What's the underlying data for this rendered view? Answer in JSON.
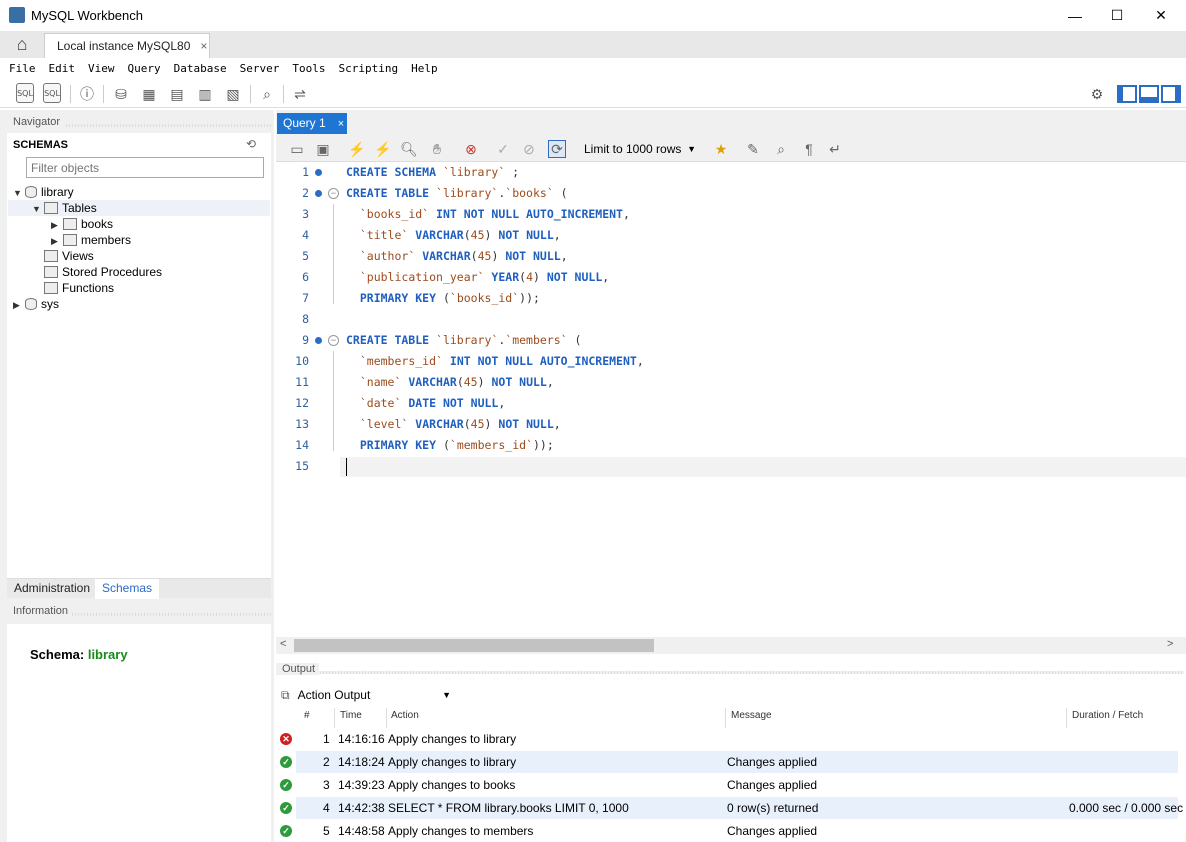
{
  "window": {
    "title": "MySQL Workbench",
    "minimize": "—",
    "maximize": "☐",
    "close": "✕"
  },
  "tabs": {
    "connection": "Local instance MySQL80",
    "close": "×"
  },
  "menu": [
    "File",
    "Edit",
    "View",
    "Query",
    "Database",
    "Server",
    "Tools",
    "Scripting",
    "Help"
  ],
  "navigator": {
    "header": "Navigator",
    "schemas_title": "SCHEMAS",
    "filter_placeholder": "Filter objects",
    "tree": {
      "library": "library",
      "tables": "Tables",
      "books": "books",
      "members": "members",
      "views": "Views",
      "stored_procedures": "Stored Procedures",
      "functions": "Functions",
      "sys": "sys"
    },
    "tabs": {
      "administration": "Administration",
      "schemas": "Schemas"
    },
    "info_header": "Information",
    "schema_label": "Schema:",
    "schema_value": "library"
  },
  "query": {
    "tab_label": "Query 1",
    "tab_close": "×",
    "limit_label": "Limit to 1000 rows",
    "line_numbers": [
      "1",
      "2",
      "3",
      "4",
      "5",
      "6",
      "7",
      "8",
      "9",
      "10",
      "11",
      "12",
      "13",
      "14",
      "15"
    ]
  },
  "output": {
    "header": "Output",
    "combo_label": "Action Output",
    "columns": {
      "num": "#",
      "time": "Time",
      "action": "Action",
      "message": "Message",
      "duration": "Duration / Fetch"
    },
    "rows": [
      {
        "status": "error",
        "num": "1",
        "time": "14:16:16",
        "action": "Apply changes to library",
        "message": "",
        "duration": ""
      },
      {
        "status": "ok",
        "num": "2",
        "time": "14:18:24",
        "action": "Apply changes to library",
        "message": "Changes applied",
        "duration": ""
      },
      {
        "status": "ok",
        "num": "3",
        "time": "14:39:23",
        "action": "Apply changes to books",
        "message": "Changes applied",
        "duration": ""
      },
      {
        "status": "ok",
        "num": "4",
        "time": "14:42:38",
        "action": "SELECT * FROM library.books LIMIT 0, 1000",
        "message": "0 row(s) returned",
        "duration": "0.000 sec / 0.000 sec"
      },
      {
        "status": "ok",
        "num": "5",
        "time": "14:48:58",
        "action": "Apply changes to members",
        "message": "Changes applied",
        "duration": ""
      }
    ]
  },
  "colors": {
    "accent": "#1f76d2",
    "keyword": "#1f5fbf",
    "identifier": "#9c4c1c",
    "ok": "#2e9a3c",
    "error": "#cc2222",
    "schema_value": "#1a8a1a"
  }
}
